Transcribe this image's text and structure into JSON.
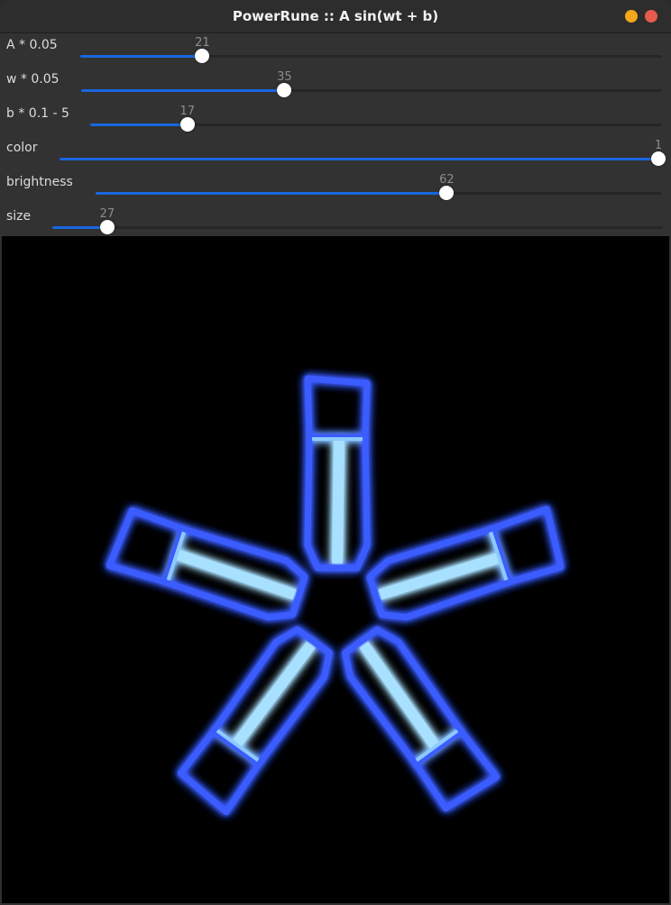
{
  "window": {
    "title": "PowerRune :: A sin(wt + b)"
  },
  "sliders": [
    {
      "label": "A * 0.05",
      "value": "21",
      "fraction": 0.21
    },
    {
      "label": "w * 0.05",
      "value": "35",
      "fraction": 0.35
    },
    {
      "label": "b * 0.1 - 5",
      "value": "17",
      "fraction": 0.17
    },
    {
      "label": "color",
      "value": "1",
      "fraction": 1.0
    },
    {
      "label": "brightness",
      "value": "62",
      "fraction": 0.62
    },
    {
      "label": "size",
      "value": "27",
      "fraction": 0.09
    }
  ],
  "colors": {
    "accent": "#1a66e0",
    "rune_glow": "#3355ff",
    "rune_core": "#9fdcff",
    "canvas": "#000000"
  },
  "icons": [
    "minimize-button",
    "close-button"
  ]
}
